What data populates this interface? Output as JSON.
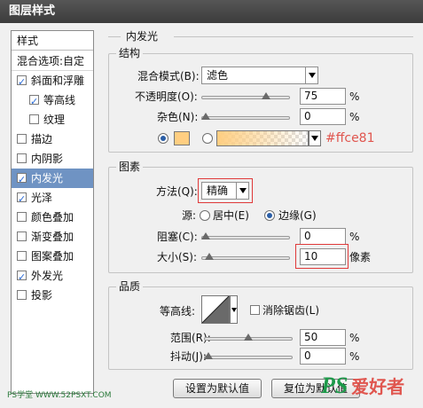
{
  "window": {
    "title": "图层样式"
  },
  "left_panel": {
    "header": "样式",
    "items": [
      {
        "label": "混合选项:自定",
        "checkbox": false,
        "checked": false,
        "indent": false,
        "selected": false
      },
      {
        "label": "斜面和浮雕",
        "checkbox": true,
        "checked": true,
        "indent": false,
        "selected": false
      },
      {
        "label": "等高线",
        "checkbox": true,
        "checked": true,
        "indent": true,
        "selected": false
      },
      {
        "label": "纹理",
        "checkbox": true,
        "checked": false,
        "indent": true,
        "selected": false
      },
      {
        "label": "描边",
        "checkbox": true,
        "checked": false,
        "indent": false,
        "selected": false
      },
      {
        "label": "内阴影",
        "checkbox": true,
        "checked": false,
        "indent": false,
        "selected": false
      },
      {
        "label": "内发光",
        "checkbox": true,
        "checked": true,
        "indent": false,
        "selected": true
      },
      {
        "label": "光泽",
        "checkbox": true,
        "checked": true,
        "indent": false,
        "selected": false
      },
      {
        "label": "颜色叠加",
        "checkbox": true,
        "checked": false,
        "indent": false,
        "selected": false
      },
      {
        "label": "渐变叠加",
        "checkbox": true,
        "checked": false,
        "indent": false,
        "selected": false
      },
      {
        "label": "图案叠加",
        "checkbox": true,
        "checked": false,
        "indent": false,
        "selected": false
      },
      {
        "label": "外发光",
        "checkbox": true,
        "checked": true,
        "indent": false,
        "selected": false
      },
      {
        "label": "投影",
        "checkbox": true,
        "checked": false,
        "indent": false,
        "selected": false
      }
    ]
  },
  "inner_glow": {
    "title": "内发光"
  },
  "structure": {
    "title": "结构",
    "blend_mode_label": "混合模式(B):",
    "blend_mode_value": "滤色",
    "opacity_label": "不透明度(O):",
    "opacity_value": "75",
    "opacity_pct": 75,
    "noise_label": "杂色(N):",
    "noise_value": "0",
    "noise_pct": 0,
    "percent": "%",
    "color_hex_note": "#ffce81",
    "glow_color": "#ffce81"
  },
  "elements": {
    "title": "图素",
    "method_label": "方法(Q):",
    "method_value": "精确",
    "source_label": "源:",
    "source_center": "居中(E)",
    "source_edge": "边缘(G)",
    "choke_label": "阻塞(C):",
    "choke_value": "0",
    "choke_pct": 0,
    "size_label": "大小(S):",
    "size_value": "10",
    "size_pct": 4,
    "percent": "%",
    "pixels": "像素"
  },
  "quality": {
    "title": "品质",
    "contour_label": "等高线:",
    "antialias_label": "消除锯齿(L)",
    "range_label": "范围(R):",
    "range_value": "50",
    "range_pct": 50,
    "jitter_label": "抖动(J):",
    "jitter_value": "0",
    "jitter_pct": 0,
    "percent": "%"
  },
  "buttons": {
    "set_default": "设置为默认值",
    "reset_default": "复位为默认值"
  },
  "watermark": {
    "left": "PS学堂 WWW.52PSXT.COM",
    "logo_ps": "PS",
    "logo_text": "爱好者"
  }
}
